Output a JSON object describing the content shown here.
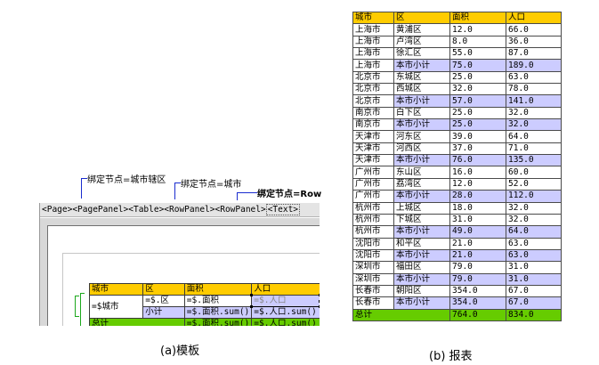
{
  "template_panel": {
    "callouts": {
      "bind_city_district": "绑定节点=城市辖区",
      "bind_city": "绑定节点=城市",
      "bind_row": "绑定节点=Row"
    },
    "breadcrumb": [
      "<Page>",
      "<PagePanel>",
      "<Table>",
      "<RowPanel>",
      "<RowPanel>",
      "<Text>"
    ],
    "table": {
      "header": [
        "城市",
        "区",
        "面积",
        "人口"
      ],
      "detail": {
        "city": "=$城市",
        "district": "=$.区",
        "area": "=$.面积",
        "population": "=$.人口"
      },
      "subtotal": {
        "label": "小计",
        "area": "=$.面积.sum()",
        "population": "=$.人口.sum()"
      },
      "total": {
        "label": "总计",
        "area": "=$.面积.sum()",
        "population": "=$.人口.sum()"
      }
    },
    "caption": "(a)模板"
  },
  "report": {
    "header": [
      "城市",
      "区",
      "面积",
      "人口"
    ],
    "rows": [
      {
        "city": "上海市",
        "district": "黄浦区",
        "area": "12.0",
        "pop": "66.0",
        "type": "detail"
      },
      {
        "city": "上海市",
        "district": "卢湾区",
        "area": "8.0",
        "pop": "36.0",
        "type": "detail"
      },
      {
        "city": "上海市",
        "district": "徐汇区",
        "area": "55.0",
        "pop": "87.0",
        "type": "detail"
      },
      {
        "city": "上海市",
        "district": "本市小计",
        "area": "75.0",
        "pop": "189.0",
        "type": "subtotal"
      },
      {
        "city": "北京市",
        "district": "东城区",
        "area": "25.0",
        "pop": "63.0",
        "type": "detail"
      },
      {
        "city": "北京市",
        "district": "西城区",
        "area": "32.0",
        "pop": "78.0",
        "type": "detail"
      },
      {
        "city": "北京市",
        "district": "本市小计",
        "area": "57.0",
        "pop": "141.0",
        "type": "subtotal"
      },
      {
        "city": "南京市",
        "district": "白下区",
        "area": "25.0",
        "pop": "32.0",
        "type": "detail"
      },
      {
        "city": "南京市",
        "district": "本市小计",
        "area": "25.0",
        "pop": "32.0",
        "type": "subtotal"
      },
      {
        "city": "天津市",
        "district": "河东区",
        "area": "39.0",
        "pop": "64.0",
        "type": "detail"
      },
      {
        "city": "天津市",
        "district": "河西区",
        "area": "37.0",
        "pop": "71.0",
        "type": "detail"
      },
      {
        "city": "天津市",
        "district": "本市小计",
        "area": "76.0",
        "pop": "135.0",
        "type": "subtotal"
      },
      {
        "city": "广州市",
        "district": "东山区",
        "area": "16.0",
        "pop": "60.0",
        "type": "detail"
      },
      {
        "city": "广州市",
        "district": "荔湾区",
        "area": "12.0",
        "pop": "52.0",
        "type": "detail"
      },
      {
        "city": "广州市",
        "district": "本市小计",
        "area": "28.0",
        "pop": "112.0",
        "type": "subtotal"
      },
      {
        "city": "杭州市",
        "district": "上城区",
        "area": "18.0",
        "pop": "32.0",
        "type": "detail"
      },
      {
        "city": "杭州市",
        "district": "下城区",
        "area": "31.0",
        "pop": "32.0",
        "type": "detail"
      },
      {
        "city": "杭州市",
        "district": "本市小计",
        "area": "49.0",
        "pop": "64.0",
        "type": "subtotal"
      },
      {
        "city": "沈阳市",
        "district": "和平区",
        "area": "21.0",
        "pop": "63.0",
        "type": "detail"
      },
      {
        "city": "沈阳市",
        "district": "本市小计",
        "area": "21.0",
        "pop": "63.0",
        "type": "subtotal"
      },
      {
        "city": "深圳市",
        "district": "福田区",
        "area": "79.0",
        "pop": "31.0",
        "type": "detail"
      },
      {
        "city": "深圳市",
        "district": "本市小计",
        "area": "79.0",
        "pop": "31.0",
        "type": "subtotal"
      },
      {
        "city": "长春市",
        "district": "朝阳区",
        "area": "354.0",
        "pop": "67.0",
        "type": "detail"
      },
      {
        "city": "长春市",
        "district": "本市小计",
        "area": "354.0",
        "pop": "67.0",
        "type": "subtotal"
      }
    ],
    "total": {
      "label": "总计",
      "area": "764.0",
      "pop": "834.0"
    },
    "caption": "(b)  报表"
  },
  "colors": {
    "header": "#ffcc00",
    "subtotal": "#ccccff",
    "total": "#66cc00",
    "callout_line": "#1a2ccf",
    "bracket": "#1ca81c"
  }
}
